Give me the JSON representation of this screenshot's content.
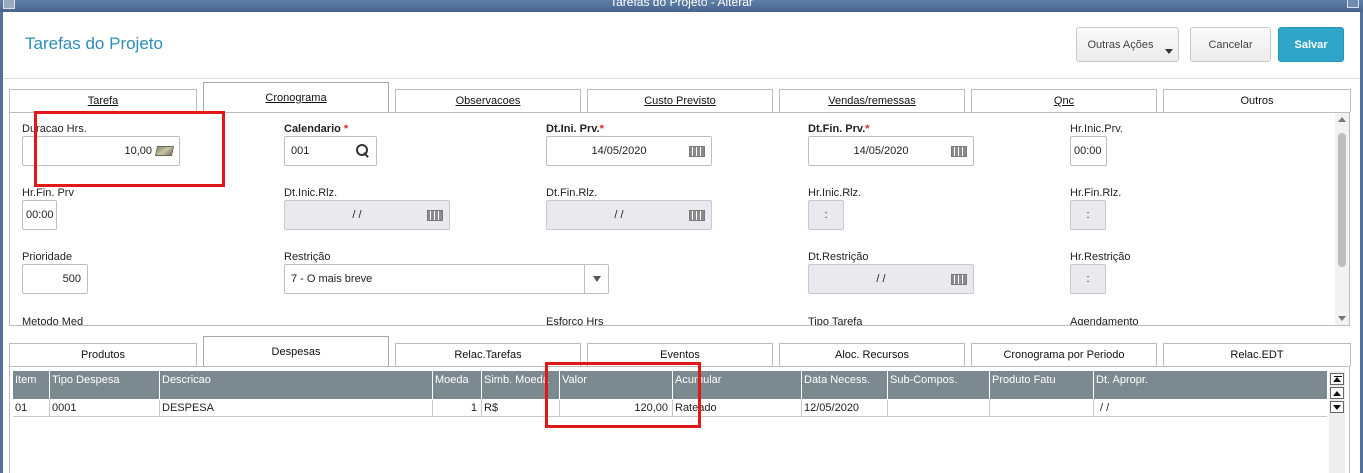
{
  "window": {
    "title": "Tarefas do Projeto - Alterar"
  },
  "header": {
    "title": "Tarefas do Projeto",
    "more_actions": "Outras Ações",
    "cancel": "Cancelar",
    "save": "Salvar"
  },
  "tabs_top": {
    "tarefa": "Tarefa",
    "cronograma": "Cronograma",
    "observacoes": "Observacoes",
    "custo_previsto": "Custo Previsto",
    "vendas": "Vendas/remessas",
    "qnc": "Qnc",
    "outros": "Outros",
    "active": "Cronograma"
  },
  "form": {
    "duracao": {
      "label": "Duracao Hrs.",
      "value": "10,00"
    },
    "calendario": {
      "label": "Calendario",
      "value": "001"
    },
    "dt_ini_prv": {
      "label": "Dt.Ini. Prv.",
      "value": "14/05/2020"
    },
    "dt_fin_prv": {
      "label": "Dt.Fin. Prv.",
      "value": "14/05/2020"
    },
    "hr_inic_prv": {
      "label": "Hr.Inic.Prv.",
      "value": "00:00"
    },
    "hr_fin_prv": {
      "label": "Hr.Fin. Prv",
      "value": "00:00"
    },
    "dt_inic_rlz": {
      "label": "Dt.Inic.Rlz.",
      "value": "/ /"
    },
    "dt_fin_rlz": {
      "label": "Dt.Fin.Rlz.",
      "value": "/ /"
    },
    "hr_inic_rlz": {
      "label": "Hr.Inic.Rlz.",
      "value": ":"
    },
    "hr_fin_rlz": {
      "label": "Hr.Fin.Rlz.",
      "value": ":"
    },
    "prioridade": {
      "label": "Prioridade",
      "value": "500"
    },
    "restricao": {
      "label": "Restrição",
      "value": "7 - O mais breve"
    },
    "dt_restricao": {
      "label": "Dt.Restrição",
      "value": "/ /"
    },
    "hr_restricao": {
      "label": "Hr.Restrição",
      "value": ":"
    },
    "metodo_med": {
      "label": "Metodo Med"
    },
    "esforco_hrs": {
      "label": "Esforco Hrs"
    },
    "tipo_tarefa": {
      "label": "Tipo Tarefa"
    },
    "agendamento": {
      "label": "Agendamento"
    },
    "required_mark": "*"
  },
  "tabs_bottom": {
    "produtos": "Produtos",
    "despesas": "Despesas",
    "relac_tarefas": "Relac.Tarefas",
    "eventos": "Eventos",
    "aloc_recursos": "Aloc. Recursos",
    "cronograma_periodo": "Cronograma por Periodo",
    "relac_edt": "Relac.EDT",
    "active": "Despesas"
  },
  "grid": {
    "columns": [
      "Item",
      "Tipo Despesa",
      "Descricao",
      "Moeda",
      "Simb. Moeda",
      "Valor",
      "Acumular",
      "Data Necess.",
      "Sub-Compos.",
      "Produto Fatu",
      "Dt. Apropr."
    ],
    "rows": [
      [
        "01",
        "0001",
        "DESPESA",
        "1",
        "R$",
        "120,00",
        "Rateado",
        "12/05/2020",
        "",
        "",
        "/ /"
      ]
    ]
  },
  "colors": {
    "accent": "#2c8fb5",
    "save_button": "#2fa4c9",
    "grid_header": "#7b8a90",
    "highlight": "#e01818"
  }
}
